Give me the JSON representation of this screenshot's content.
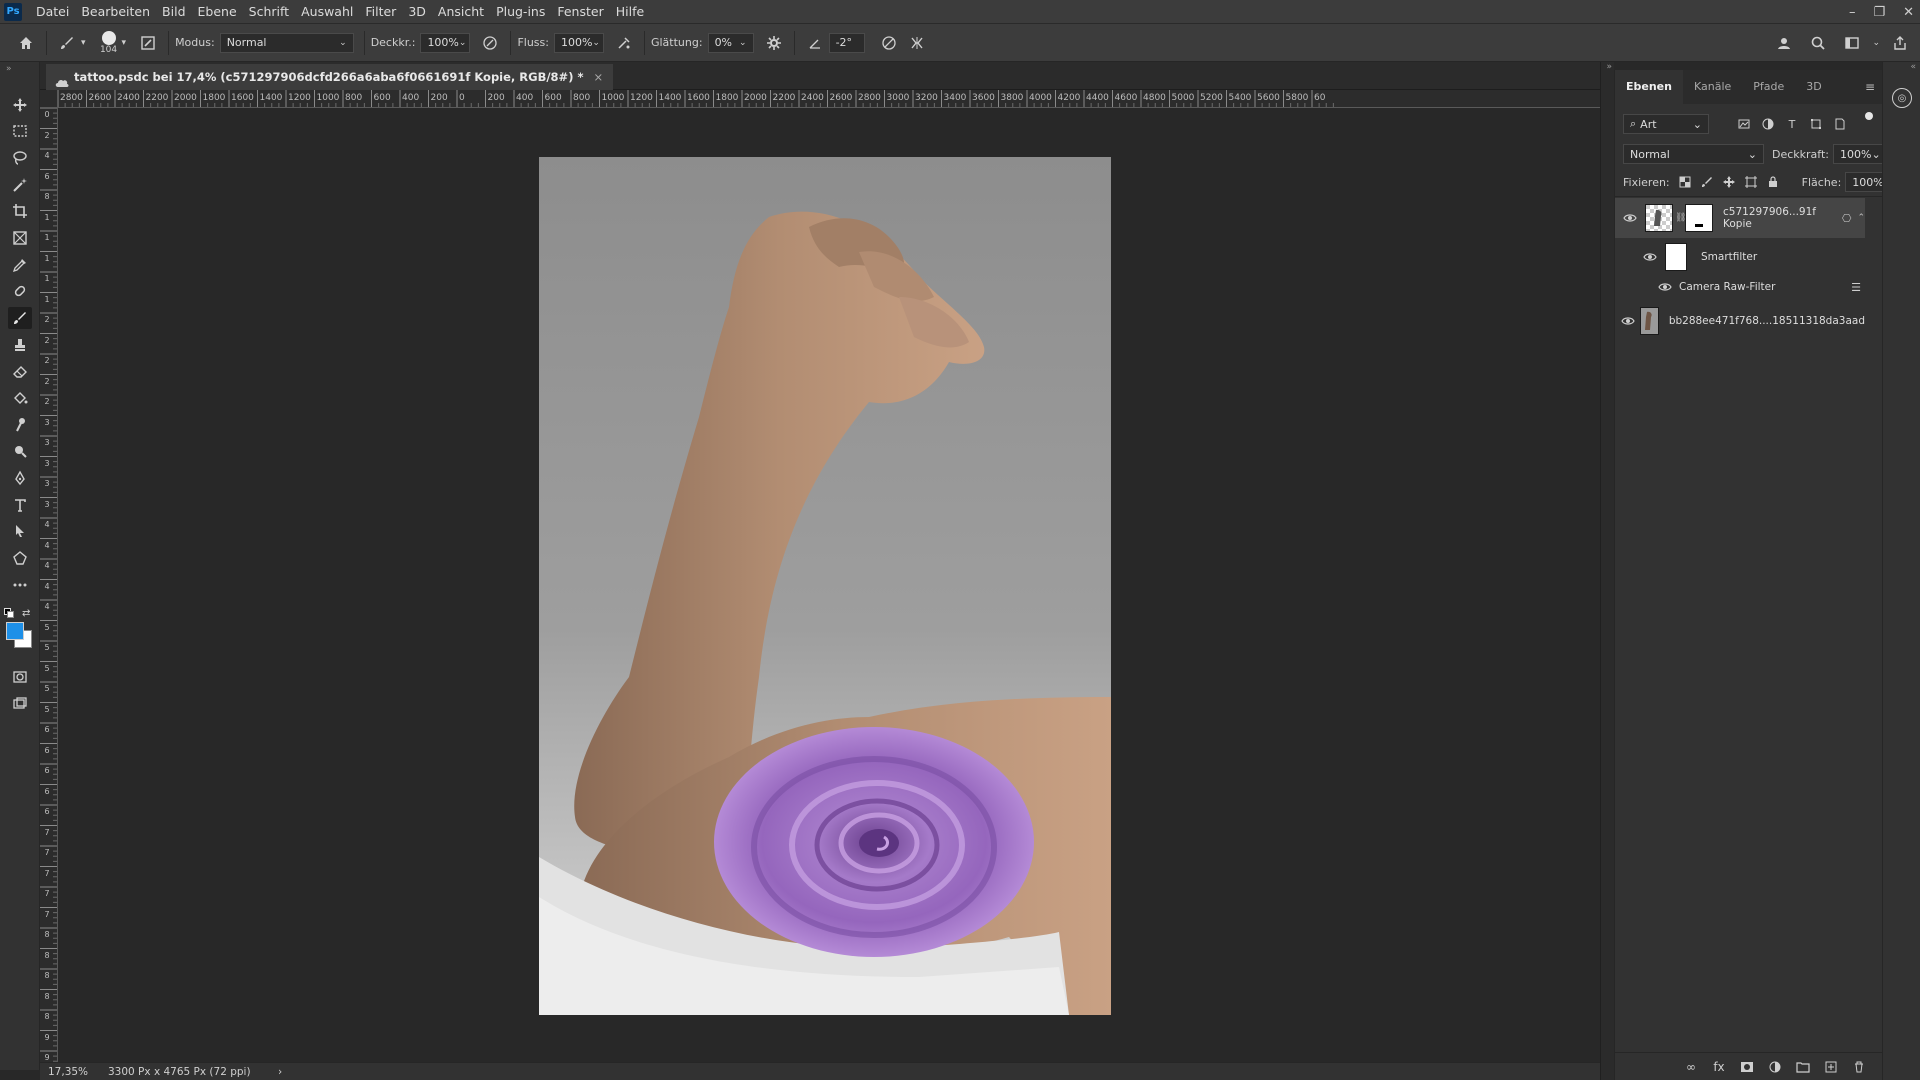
{
  "app": {
    "logo": "Ps"
  },
  "menu": [
    "Datei",
    "Bearbeiten",
    "Bild",
    "Ebene",
    "Schrift",
    "Auswahl",
    "Filter",
    "3D",
    "Ansicht",
    "Plug-ins",
    "Fenster",
    "Hilfe"
  ],
  "window_controls": {
    "minimize": "–",
    "restore": "❐",
    "close": "✕"
  },
  "options": {
    "brush_size": "104",
    "mode_label": "Modus:",
    "mode_value": "Normal",
    "opacity_label": "Deckkr.:",
    "opacity_value": "100%",
    "flow_label": "Fluss:",
    "flow_value": "100%",
    "smoothing_label": "Glättung:",
    "smoothing_value": "0%",
    "angle_value": "-2°"
  },
  "document": {
    "tab_title": "tattoo.psdc bei 17,4% (c571297906dcfd266a6aba6f0661691f Kopie, RGB/8#) *",
    "close": "×"
  },
  "ruler": {
    "h_labels": [
      "2800",
      "2600",
      "2400",
      "2200",
      "2000",
      "1800",
      "1600",
      "1400",
      "1200",
      "1000",
      "800",
      "600",
      "400",
      "200",
      "0",
      "200",
      "400",
      "600",
      "800",
      "1000",
      "1200",
      "1400",
      "1600",
      "1800",
      "2000",
      "2200",
      "2400",
      "2600",
      "2800",
      "3000",
      "3200",
      "3400",
      "3600",
      "3800",
      "4000",
      "4200",
      "4400",
      "4600",
      "4800",
      "5000",
      "5200",
      "5400",
      "5600",
      "5800",
      "60"
    ],
    "v_labels": [
      "0",
      "2",
      "4",
      "6",
      "8",
      "1",
      "1",
      "1",
      "1",
      "1",
      "2",
      "2",
      "2",
      "2",
      "2",
      "3",
      "3",
      "3",
      "3",
      "3",
      "4",
      "4",
      "4",
      "4",
      "4",
      "5",
      "5",
      "5",
      "5",
      "5",
      "6",
      "6",
      "6",
      "6",
      "6",
      "7",
      "7",
      "7",
      "7",
      "7",
      "8",
      "8",
      "8",
      "8",
      "8",
      "9",
      "9"
    ]
  },
  "status": {
    "zoom": "17,35%",
    "doc_size": "3300 Px x 4765 Px (72 ppi)",
    "arrow": "›"
  },
  "colors": {
    "foreground": "#1e90e8",
    "background": "#ffffff",
    "rose": "#9b6bc4"
  },
  "layers_panel": {
    "tabs": [
      "Ebenen",
      "Kanäle",
      "Pfade",
      "3D"
    ],
    "filter_kind": "Art",
    "blend_mode": "Normal",
    "opacity_label": "Deckkraft:",
    "opacity_value": "100%",
    "lock_label": "Fixieren:",
    "fill_label": "Fläche:",
    "fill_value": "100%",
    "layers": [
      {
        "name": "c571297906...91f Kopie",
        "selected": true
      },
      {
        "name": "Smartfilter"
      },
      {
        "name": "Camera Raw-Filter"
      },
      {
        "name": "bb288ee471f768....18511318da3aad"
      }
    ]
  }
}
